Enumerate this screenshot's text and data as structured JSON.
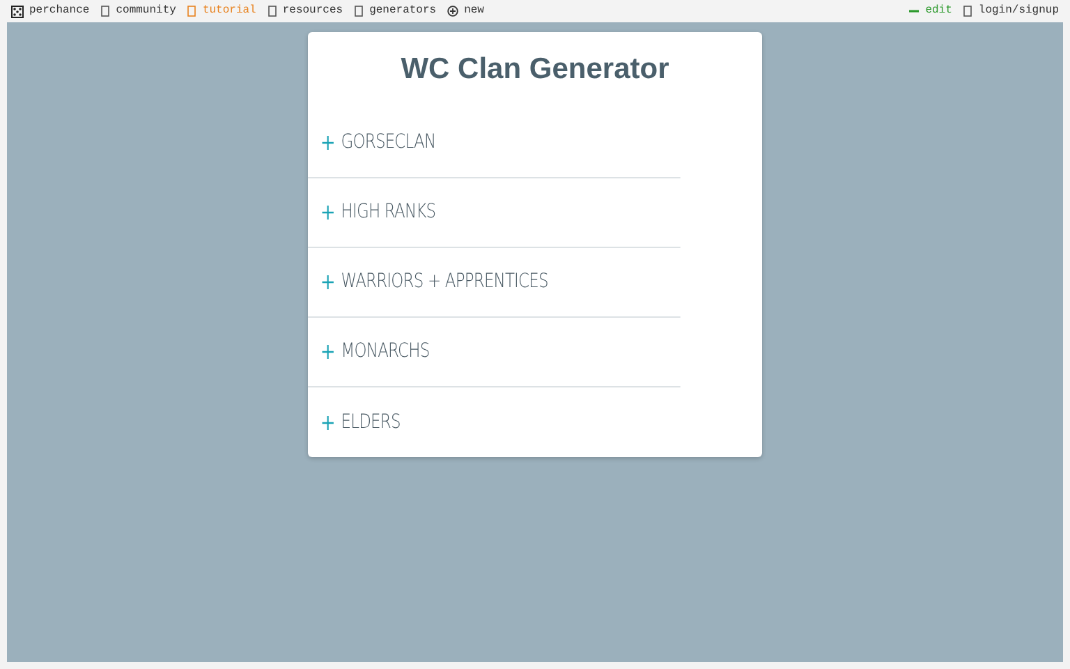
{
  "topbar": {
    "left": [
      {
        "label": "perchance",
        "color": "#333333"
      },
      {
        "label": "community",
        "color": "#333333"
      },
      {
        "label": "tutorial",
        "color": "#e8821e"
      },
      {
        "label": "resources",
        "color": "#333333"
      },
      {
        "label": "generators",
        "color": "#333333"
      },
      {
        "label": "new",
        "color": "#333333"
      }
    ],
    "right": [
      {
        "label": "edit",
        "color": "#2e9a2e"
      },
      {
        "label": "login/signup",
        "color": "#333333"
      }
    ]
  },
  "title": "WC Clan Generator",
  "sections": [
    {
      "label": "GORSECLAN",
      "expanded": false
    },
    {
      "label": "HIGH RANKS",
      "expanded": false
    },
    {
      "label": "WARRIORS + APPRENTICES",
      "expanded": false
    },
    {
      "label": "MONARCHS",
      "expanded": false
    },
    {
      "label": "ELDERS",
      "expanded": false
    }
  ]
}
